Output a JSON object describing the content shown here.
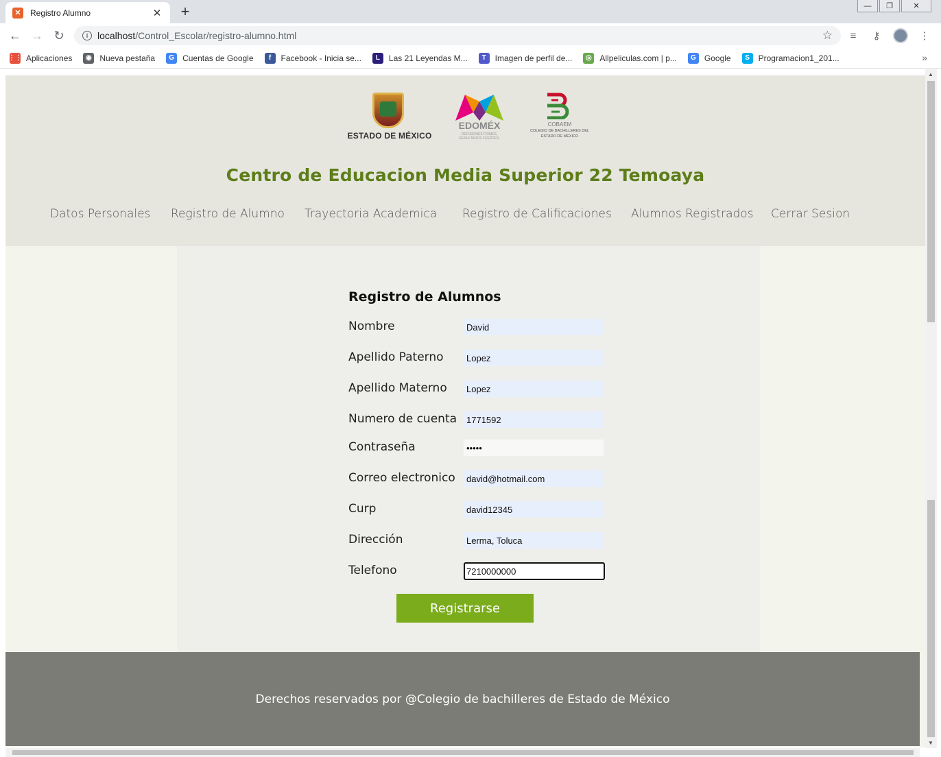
{
  "browser": {
    "tab_title": "Registro Alumno",
    "tab_close": "✕",
    "new_tab": "+",
    "url_host": "localhost",
    "url_path": "/Control_Escolar/registro-alumno.html",
    "bookmarks": [
      {
        "label": "Aplicaciones",
        "icon": "apps-grid-icon",
        "color": "#e84f3c"
      },
      {
        "label": "Nueva pestaña",
        "icon": "globe-icon",
        "color": "#5f6368"
      },
      {
        "label": "Cuentas de Google",
        "icon": "google-icon",
        "color": "#4285f4"
      },
      {
        "label": "Facebook - Inicia se...",
        "icon": "facebook-icon",
        "color": "#3b5998"
      },
      {
        "label": "Las 21 Leyendas M...",
        "icon": "letter-l-icon",
        "color": "#2a1e7a"
      },
      {
        "label": "Imagen de perfil de...",
        "icon": "teams-icon",
        "color": "#5059c9"
      },
      {
        "label": "Allpeliculas.com | p...",
        "icon": "allpeliculas-icon",
        "color": "#6aa84f"
      },
      {
        "label": "Google",
        "icon": "google-icon",
        "color": "#4285f4"
      },
      {
        "label": "Programacion1_201...",
        "icon": "skype-icon",
        "color": "#00aff0"
      }
    ]
  },
  "header": {
    "logo1_text": "ESTADO DE MÉXICO",
    "logo2_text": "EDOMÉX",
    "logo2_sub": "DECISIONES FIRMES, RESULTADOS FUERTES.",
    "logo3_text": "COBAEM",
    "logo3_sub": "COLEGIO DE BACHILLERES DEL ESTADO DE MÉXICO",
    "school_name": "Centro de Educacion Media Superior 22 Temoaya",
    "menu": [
      "Datos Personales",
      "Registro de Alumno",
      "Trayectoria Academica",
      "Registro de Calificaciones",
      "Alumnos Registrados",
      "Cerrar Sesion"
    ]
  },
  "form": {
    "title": "Registro de Alumnos",
    "fields": [
      {
        "label": "Nombre",
        "value": "David"
      },
      {
        "label": "Apellido Paterno",
        "value": "Lopez"
      },
      {
        "label": "Apellido Materno",
        "value": "Lopez"
      },
      {
        "label": "Numero de cuenta",
        "value": "1771592"
      },
      {
        "label": "Contraseña",
        "value": "•••••"
      },
      {
        "label": "Correo electronico",
        "value": "david@hotmail.com"
      },
      {
        "label": "Curp",
        "value": "david12345"
      },
      {
        "label": "Dirección",
        "value": "Lerma, Toluca"
      },
      {
        "label": "Telefono",
        "value": "7210000000"
      }
    ],
    "submit_label": "Registrarse"
  },
  "footer": {
    "text": "Derechos reservados por @Colegio de bachilleres de Estado de México"
  },
  "colors": {
    "accent_green": "#7aac1c",
    "title_green": "#5d7d1a",
    "footer_gray": "#7b7c76",
    "header_bg": "#e6e6de"
  }
}
